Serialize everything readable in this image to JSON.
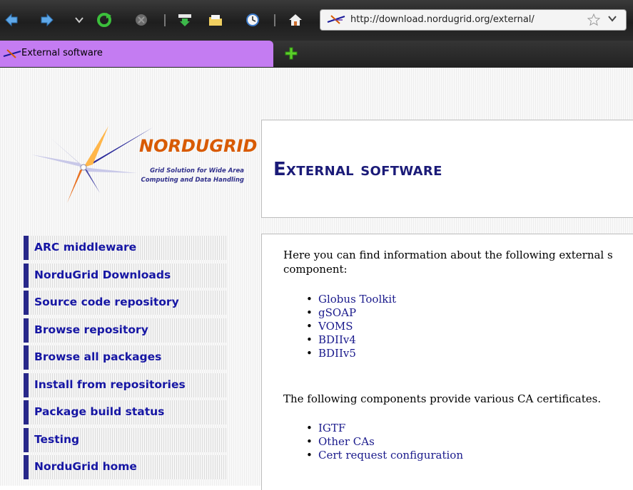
{
  "browser": {
    "url": "http://download.nordugrid.org/external/",
    "tab_title": "External software",
    "icons": [
      "back-icon",
      "forward-icon",
      "history-dropdown-icon",
      "reload-icon",
      "stop-icon",
      "download-icon",
      "bookmarks-icon",
      "history-icon",
      "home-icon",
      "star-icon",
      "chevron-down-icon",
      "new-tab-icon"
    ]
  },
  "logo": {
    "name": "NORDUGRID",
    "tagline_line1": "Grid Solution for Wide Area",
    "tagline_line2": "Computing and Data Handling"
  },
  "page": {
    "title": "External software"
  },
  "nav": {
    "items": [
      {
        "label": "ARC middleware"
      },
      {
        "label": "NorduGrid Downloads"
      },
      {
        "label": "Source code repository"
      },
      {
        "label": "Browse repository"
      },
      {
        "label": "Browse all packages"
      },
      {
        "label": "Install from repositories"
      },
      {
        "label": "Package build status"
      },
      {
        "label": "Testing"
      },
      {
        "label": "NorduGrid home"
      }
    ]
  },
  "content": {
    "intro_line1": "Here you can find information about the following external s",
    "intro_line2": "component:",
    "links1": [
      {
        "label": "Globus Toolkit"
      },
      {
        "label": "gSOAP"
      },
      {
        "label": "VOMS"
      },
      {
        "label": "BDIIv4"
      },
      {
        "label": "BDIIv5"
      }
    ],
    "ca_intro": "The following components provide various CA certificates.",
    "links2": [
      {
        "label": "IGTF"
      },
      {
        "label": "Other CAs"
      },
      {
        "label": "Cert request configuration"
      }
    ]
  },
  "colors": {
    "tab_active": "#c47cf2",
    "nav_link": "#1616a4",
    "nav_border": "#28288a",
    "title": "#1b1b78",
    "logo_orange": "#d85a00"
  }
}
